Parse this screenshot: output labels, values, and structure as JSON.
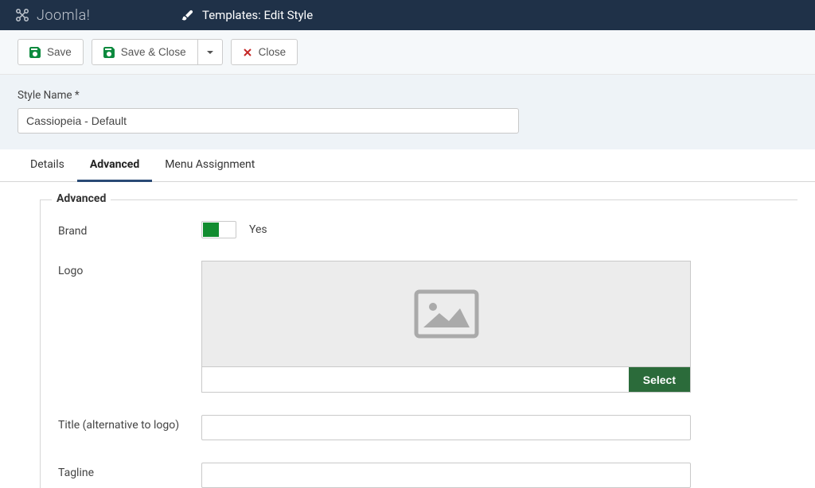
{
  "header": {
    "brand": "Joomla!",
    "page_title": "Templates: Edit Style"
  },
  "toolbar": {
    "save_label": "Save",
    "save_close_label": "Save & Close",
    "close_label": "Close"
  },
  "style_name": {
    "label": "Style Name *",
    "value": "Cassiopeia - Default"
  },
  "tabs": [
    {
      "label": "Details"
    },
    {
      "label": "Advanced"
    },
    {
      "label": "Menu Assignment"
    }
  ],
  "advanced": {
    "legend": "Advanced",
    "brand": {
      "label": "Brand",
      "state_label": "Yes"
    },
    "logo": {
      "label": "Logo",
      "select_label": "Select",
      "value": ""
    },
    "title_field": {
      "label": "Title (alternative to logo)",
      "value": ""
    },
    "tagline": {
      "label": "Tagline",
      "value": ""
    }
  }
}
